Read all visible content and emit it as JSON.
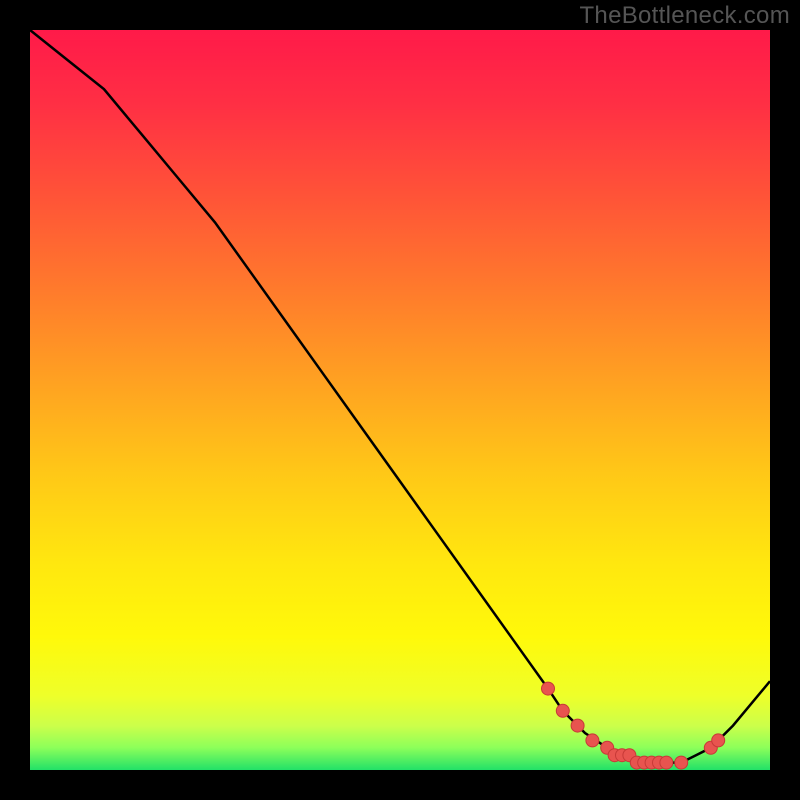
{
  "attribution": "TheBottleneck.com",
  "colors": {
    "bg": "#000000",
    "attribution_text": "#555555",
    "curve": "#000000",
    "dot_fill": "#e8544f",
    "dot_stroke": "#c73a37"
  },
  "gradient_stops": [
    {
      "offset": 0.0,
      "color": "#ff1a49"
    },
    {
      "offset": 0.1,
      "color": "#ff2f44"
    },
    {
      "offset": 0.22,
      "color": "#ff5238"
    },
    {
      "offset": 0.35,
      "color": "#ff7a2c"
    },
    {
      "offset": 0.48,
      "color": "#ffa321"
    },
    {
      "offset": 0.6,
      "color": "#ffc817"
    },
    {
      "offset": 0.72,
      "color": "#ffe70f"
    },
    {
      "offset": 0.82,
      "color": "#fff90a"
    },
    {
      "offset": 0.9,
      "color": "#eeff2a"
    },
    {
      "offset": 0.94,
      "color": "#ccff4a"
    },
    {
      "offset": 0.97,
      "color": "#8cff5a"
    },
    {
      "offset": 1.0,
      "color": "#22e168"
    }
  ],
  "chart_data": {
    "type": "line",
    "title": "",
    "xlabel": "",
    "ylabel": "",
    "xlim": [
      0,
      100
    ],
    "ylim": [
      0,
      100
    ],
    "series": [
      {
        "name": "bottleneck-curve",
        "x": [
          0,
          5,
          10,
          15,
          20,
          25,
          30,
          35,
          40,
          45,
          50,
          55,
          60,
          65,
          70,
          72,
          75,
          78,
          80,
          82,
          84,
          86,
          88,
          90,
          92,
          95,
          100
        ],
        "y": [
          100,
          96,
          92,
          86,
          80,
          74,
          67,
          60,
          53,
          46,
          39,
          32,
          25,
          18,
          11,
          8,
          5,
          3,
          2,
          1,
          1,
          1,
          1,
          2,
          3,
          6,
          12
        ]
      }
    ],
    "highlighted_points": {
      "name": "optimal-range",
      "x": [
        70,
        72,
        74,
        76,
        78,
        79,
        80,
        81,
        82,
        83,
        84,
        85,
        86,
        88,
        92,
        93
      ],
      "y": [
        11,
        8,
        6,
        4,
        3,
        2,
        2,
        2,
        1,
        1,
        1,
        1,
        1,
        1,
        3,
        4
      ]
    }
  }
}
